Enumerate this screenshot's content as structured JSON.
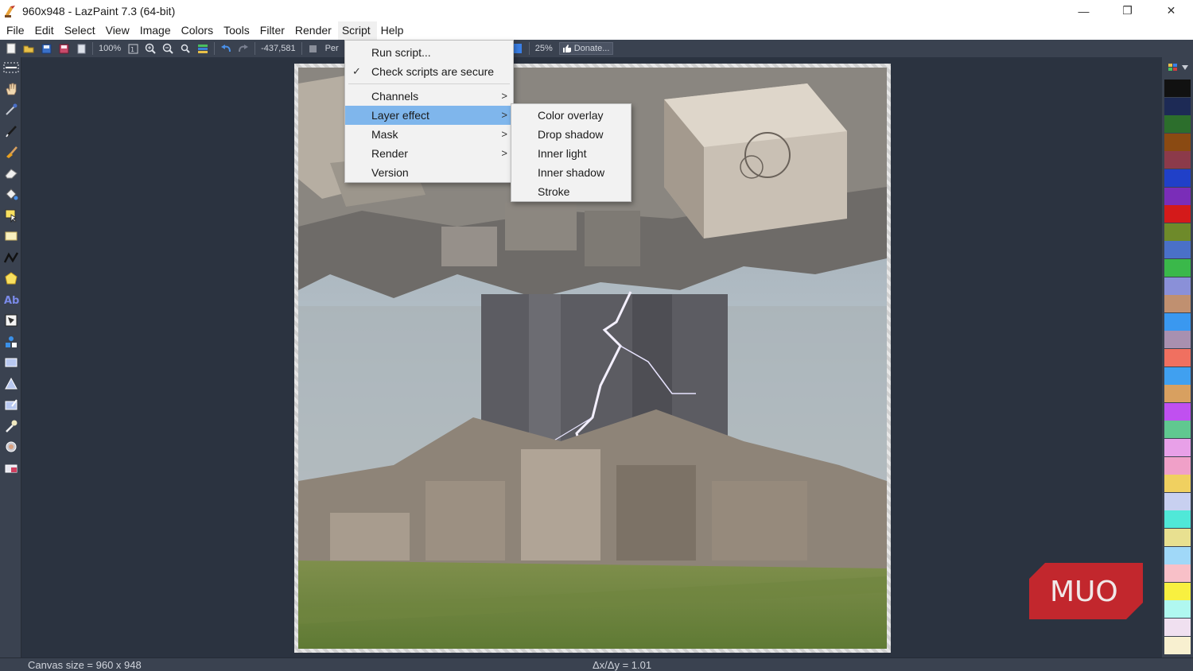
{
  "window": {
    "title": "960x948 - LazPaint 7.3 (64-bit)",
    "minimize": "—",
    "maximize": "❐",
    "close": "✕"
  },
  "menubar": [
    "File",
    "Edit",
    "Select",
    "View",
    "Image",
    "Colors",
    "Tools",
    "Filter",
    "Render",
    "Script",
    "Help"
  ],
  "toolbar": {
    "zoom_value": "100%",
    "coordinates": "-437,581",
    "partial_label": "Per",
    "zoom_percent": "25%",
    "donate_label": "Donate..."
  },
  "script_menu": {
    "items": [
      {
        "label": "Run script..."
      },
      {
        "label": "Check scripts are secure",
        "checked": true
      },
      {
        "label": "Channels",
        "submenu": true
      },
      {
        "label": "Layer effect",
        "submenu": true,
        "highlighted": true
      },
      {
        "label": "Mask",
        "submenu": true
      },
      {
        "label": "Render",
        "submenu": true
      },
      {
        "label": "Version"
      }
    ],
    "check_glyph": "✓",
    "arrow_glyph": ">"
  },
  "layer_effect_submenu": {
    "items": [
      "Color overlay",
      "Drop shadow",
      "Inner light",
      "Inner shadow",
      "Stroke"
    ]
  },
  "status": {
    "canvas_size": "Canvas size = 960 x 948",
    "ratio": "Δx/Δy = 1.01"
  },
  "palette_colors": [
    "#111111",
    "#1d2a55",
    "#2c6e2c",
    "#8a4a12",
    "#8c3a4a",
    "#2040c8",
    "#7a2db8",
    "#d41a1a",
    "#6e8a2a",
    "#4a70c8",
    "#3ab84a",
    "#8a90d8",
    "#c09070",
    "#3a98f0",
    "#a890b0",
    "#f07060",
    "#40a0f0",
    "#d8a060",
    "#c050f0",
    "#60c890",
    "#e8a0e8",
    "#f0a0c8",
    "#f0d060",
    "#c8d0f0",
    "#50e8d8",
    "#e8e090",
    "#a0d8f8",
    "#f8c0c8",
    "#f8f040",
    "#b0f8f0",
    "#f0e0f0",
    "#f8f0d0"
  ],
  "watermark": "MUO"
}
